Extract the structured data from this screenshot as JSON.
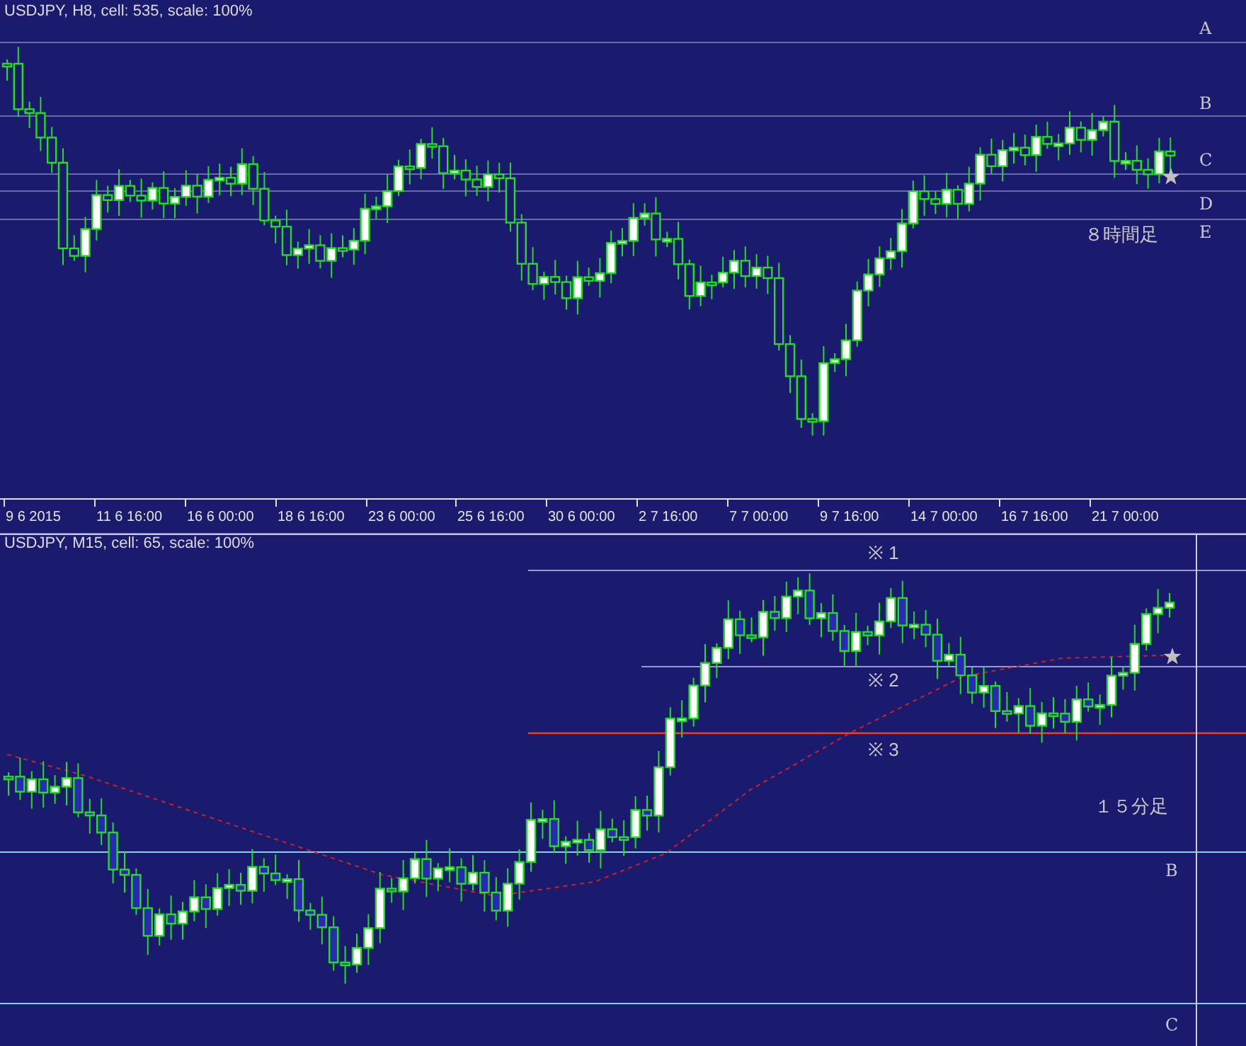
{
  "top_chart": {
    "title": "USDJPY, H8, cell: 535, scale: 100%",
    "levels": [
      {
        "label": "A"
      },
      {
        "label": "B"
      },
      {
        "label": "C"
      },
      {
        "label": "D"
      },
      {
        "label": "E"
      }
    ],
    "caption": "８時間足",
    "x_labels": [
      "9 6 2015",
      "11 6 16:00",
      "16 6 00:00",
      "18 6 16:00",
      "23 6 00:00",
      "25 6 16:00",
      "30 6 00:00",
      "2 7 16:00",
      "7 7 00:00",
      "9 7 16:00",
      "14 7 00:00",
      "16 7 16:00",
      "21 7 00:00"
    ]
  },
  "bottom_chart": {
    "title": "USDJPY, M15, cell: 65, scale: 100%",
    "notes": [
      "※ 1",
      "※ 2",
      "※ 3"
    ],
    "levels": [
      {
        "label": "B"
      },
      {
        "label": "C"
      }
    ],
    "caption": "１５分足"
  }
}
